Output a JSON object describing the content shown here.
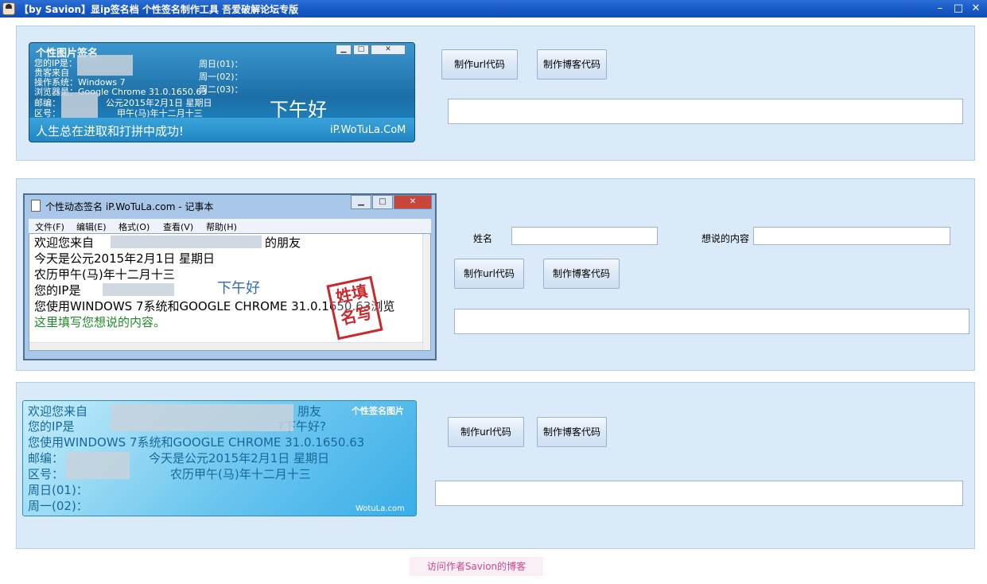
{
  "window": {
    "title": "【by Savion】显ip签名档 个性签名制作工具  吾爱破解论坛专版",
    "min": "–",
    "max": "□",
    "close": "✕"
  },
  "buttons": {
    "url": "制作url代码",
    "blog": "制作博客代码"
  },
  "panel1": {
    "card": {
      "title": "个性图片签名",
      "lines": [
        "您的IP是：",
        "贵客来自",
        "操作系统：Windows 7",
        "浏览器是：Google Chrome 31.0.1650.63",
        "邮编：",
        "区号："
      ],
      "days": [
        "周日(01)：",
        "周一(02)：",
        "周二(03)："
      ],
      "date": "公元2015年2月1日 星期日",
      "lunar": "甲午(马)年十二月十三",
      "greeting": "下午好",
      "motto": "人生总在进取和打拼中成功!",
      "site": "iP.WoTuLa.CoM"
    },
    "output": ""
  },
  "panel2": {
    "name_label": "姓名",
    "content_label": "想说的内容",
    "name_value": "",
    "content_value": "",
    "output": "",
    "notepad": {
      "title": "个性动态签名 iP.WoTuLa.com - 记事本",
      "menu": [
        "文件(F)",
        "编辑(E)",
        "格式(O)",
        "查看(V)",
        "帮助(H)"
      ],
      "lines": [
        "欢迎您来自",
        "的朋友",
        "今天是公元2015年2月1日 星期日",
        "农历甲午(马)年十二月十三",
        "您的IP是",
        "您使用WINDOWS 7系统和GOOGLE CHROME 31.0.1650.63浏览",
        "这里填写您想说的内容。"
      ],
      "greeting": "下午好",
      "stamp": "姓填名写"
    }
  },
  "panel3": {
    "card": {
      "tag": "个性签名图片",
      "lines": [
        "欢迎您来自",
        "朋友",
        "您的IP是",
        "?下午好?",
        "您使用WINDOWS 7系统和GOOGLE CHROME 31.0.1650.63",
        "邮编：",
        "今天是公元2015年2月1日 星期日",
        "区号：",
        "农历甲午(马)年十二月十三",
        "周日(01)：",
        "周一(02)："
      ],
      "site": "WotuLa.com"
    },
    "output": ""
  },
  "footer_link": "访问作者Savion的博客",
  "colors": {
    "titlebar": "#1657c4",
    "panel_bg": "#dbeaf8",
    "link": "#d0458e"
  }
}
